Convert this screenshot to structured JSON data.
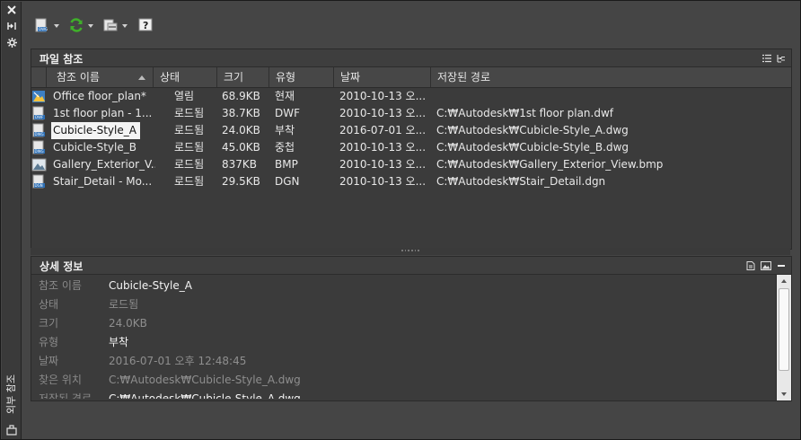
{
  "window": {
    "side_title": "외부 참조"
  },
  "file_refs": {
    "title": "파일 참조",
    "columns": [
      "참조 이름",
      "상태",
      "크기",
      "유형",
      "날짜",
      "저장된 경로"
    ],
    "rows": [
      {
        "name": "Office floor_plan*",
        "status": "열림",
        "size": "68.9KB",
        "type": "현재",
        "date": "2010-10-13 오...",
        "path": "",
        "icon": "dwg-drawing-icon"
      },
      {
        "name": "1st floor plan - 1...",
        "status": "로드됨",
        "size": "38.7KB",
        "type": "DWF",
        "date": "2010-10-13 오...",
        "path": "C:₩Autodesk₩1st floor plan.dwf",
        "icon": "dwf-file-icon"
      },
      {
        "name": "Cubicle-Style_A",
        "status": "로드됨",
        "size": "24.0KB",
        "type": "부착",
        "date": "2016-07-01 오...",
        "path": "C:₩Autodesk₩Cubicle-Style_A.dwg",
        "icon": "dwg-file-icon",
        "selected": true
      },
      {
        "name": "Cubicle-Style_B",
        "status": "로드됨",
        "size": "45.0KB",
        "type": "중첩",
        "date": "2010-10-13 오...",
        "path": "C:₩Autodesk₩Cubicle-Style_B.dwg",
        "icon": "dwg-file-icon"
      },
      {
        "name": "Gallery_Exterior_V...",
        "status": "로드됨",
        "size": "837KB",
        "type": "BMP",
        "date": "2010-10-13 오...",
        "path": "C:₩Autodesk₩Gallery_Exterior_View.bmp",
        "icon": "image-file-icon"
      },
      {
        "name": "Stair_Detail - Mo...",
        "status": "로드됨",
        "size": "29.5KB",
        "type": "DGN",
        "date": "2010-10-13 오...",
        "path": "C:₩Autodesk₩Stair_Detail.dgn",
        "icon": "dgn-file-icon"
      }
    ]
  },
  "details": {
    "title": "상세 정보",
    "rows": [
      {
        "label": "참조 이름",
        "value": "Cubicle-Style_A"
      },
      {
        "label": "상태",
        "value": "로드됨"
      },
      {
        "label": "크기",
        "value": "24.0KB"
      },
      {
        "label": "유형",
        "value": "부착"
      },
      {
        "label": "날짜",
        "value": "2016-07-01 오후 12:48:45"
      },
      {
        "label": "찾은 위치",
        "value": "C:₩Autodesk₩Cubicle-Style_A.dwg"
      },
      {
        "label": "저장된 경로",
        "value": "C:₩Autodesk₩Cubicle-Style_A.dwg"
      }
    ]
  },
  "icons": {
    "close": "close-icon",
    "pin": "auto-hide-icon",
    "settings": "settings-icon",
    "attach": "attach-dwg-icon",
    "refresh": "refresh-icon",
    "change_path": "change-path-icon",
    "help": "help-icon",
    "list_view": "list-view-icon",
    "tree_view": "tree-view-icon",
    "details_view": "details-view-icon",
    "preview_view": "preview-icon",
    "minimize": "minimize-icon",
    "side_bottom": "palette-properties-icon"
  },
  "colors": {
    "panel_bg": "#3b3b3b",
    "selection": "#f4f4f4",
    "refresh_green": "#3fae2a"
  }
}
